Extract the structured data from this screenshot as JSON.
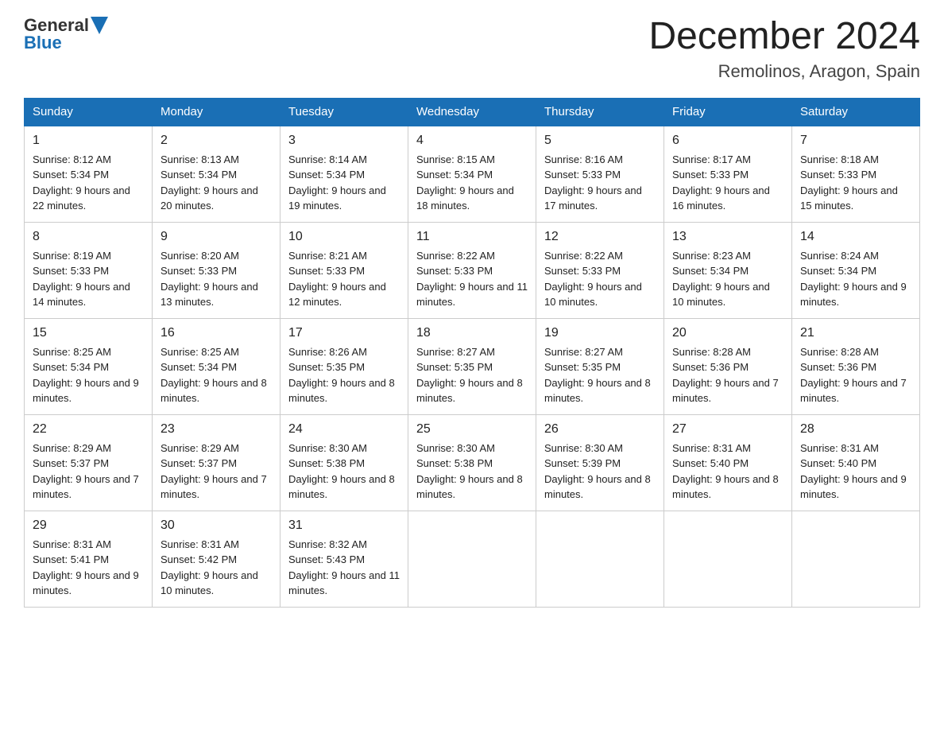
{
  "header": {
    "logo_general": "General",
    "logo_blue": "Blue",
    "month_title": "December 2024",
    "location": "Remolinos, Aragon, Spain"
  },
  "days_of_week": [
    "Sunday",
    "Monday",
    "Tuesday",
    "Wednesday",
    "Thursday",
    "Friday",
    "Saturday"
  ],
  "weeks": [
    [
      {
        "day": "1",
        "sunrise": "8:12 AM",
        "sunset": "5:34 PM",
        "daylight": "9 hours and 22 minutes."
      },
      {
        "day": "2",
        "sunrise": "8:13 AM",
        "sunset": "5:34 PM",
        "daylight": "9 hours and 20 minutes."
      },
      {
        "day": "3",
        "sunrise": "8:14 AM",
        "sunset": "5:34 PM",
        "daylight": "9 hours and 19 minutes."
      },
      {
        "day": "4",
        "sunrise": "8:15 AM",
        "sunset": "5:34 PM",
        "daylight": "9 hours and 18 minutes."
      },
      {
        "day": "5",
        "sunrise": "8:16 AM",
        "sunset": "5:33 PM",
        "daylight": "9 hours and 17 minutes."
      },
      {
        "day": "6",
        "sunrise": "8:17 AM",
        "sunset": "5:33 PM",
        "daylight": "9 hours and 16 minutes."
      },
      {
        "day": "7",
        "sunrise": "8:18 AM",
        "sunset": "5:33 PM",
        "daylight": "9 hours and 15 minutes."
      }
    ],
    [
      {
        "day": "8",
        "sunrise": "8:19 AM",
        "sunset": "5:33 PM",
        "daylight": "9 hours and 14 minutes."
      },
      {
        "day": "9",
        "sunrise": "8:20 AM",
        "sunset": "5:33 PM",
        "daylight": "9 hours and 13 minutes."
      },
      {
        "day": "10",
        "sunrise": "8:21 AM",
        "sunset": "5:33 PM",
        "daylight": "9 hours and 12 minutes."
      },
      {
        "day": "11",
        "sunrise": "8:22 AM",
        "sunset": "5:33 PM",
        "daylight": "9 hours and 11 minutes."
      },
      {
        "day": "12",
        "sunrise": "8:22 AM",
        "sunset": "5:33 PM",
        "daylight": "9 hours and 10 minutes."
      },
      {
        "day": "13",
        "sunrise": "8:23 AM",
        "sunset": "5:34 PM",
        "daylight": "9 hours and 10 minutes."
      },
      {
        "day": "14",
        "sunrise": "8:24 AM",
        "sunset": "5:34 PM",
        "daylight": "9 hours and 9 minutes."
      }
    ],
    [
      {
        "day": "15",
        "sunrise": "8:25 AM",
        "sunset": "5:34 PM",
        "daylight": "9 hours and 9 minutes."
      },
      {
        "day": "16",
        "sunrise": "8:25 AM",
        "sunset": "5:34 PM",
        "daylight": "9 hours and 8 minutes."
      },
      {
        "day": "17",
        "sunrise": "8:26 AM",
        "sunset": "5:35 PM",
        "daylight": "9 hours and 8 minutes."
      },
      {
        "day": "18",
        "sunrise": "8:27 AM",
        "sunset": "5:35 PM",
        "daylight": "9 hours and 8 minutes."
      },
      {
        "day": "19",
        "sunrise": "8:27 AM",
        "sunset": "5:35 PM",
        "daylight": "9 hours and 8 minutes."
      },
      {
        "day": "20",
        "sunrise": "8:28 AM",
        "sunset": "5:36 PM",
        "daylight": "9 hours and 7 minutes."
      },
      {
        "day": "21",
        "sunrise": "8:28 AM",
        "sunset": "5:36 PM",
        "daylight": "9 hours and 7 minutes."
      }
    ],
    [
      {
        "day": "22",
        "sunrise": "8:29 AM",
        "sunset": "5:37 PM",
        "daylight": "9 hours and 7 minutes."
      },
      {
        "day": "23",
        "sunrise": "8:29 AM",
        "sunset": "5:37 PM",
        "daylight": "9 hours and 7 minutes."
      },
      {
        "day": "24",
        "sunrise": "8:30 AM",
        "sunset": "5:38 PM",
        "daylight": "9 hours and 8 minutes."
      },
      {
        "day": "25",
        "sunrise": "8:30 AM",
        "sunset": "5:38 PM",
        "daylight": "9 hours and 8 minutes."
      },
      {
        "day": "26",
        "sunrise": "8:30 AM",
        "sunset": "5:39 PM",
        "daylight": "9 hours and 8 minutes."
      },
      {
        "day": "27",
        "sunrise": "8:31 AM",
        "sunset": "5:40 PM",
        "daylight": "9 hours and 8 minutes."
      },
      {
        "day": "28",
        "sunrise": "8:31 AM",
        "sunset": "5:40 PM",
        "daylight": "9 hours and 9 minutes."
      }
    ],
    [
      {
        "day": "29",
        "sunrise": "8:31 AM",
        "sunset": "5:41 PM",
        "daylight": "9 hours and 9 minutes."
      },
      {
        "day": "30",
        "sunrise": "8:31 AM",
        "sunset": "5:42 PM",
        "daylight": "9 hours and 10 minutes."
      },
      {
        "day": "31",
        "sunrise": "8:32 AM",
        "sunset": "5:43 PM",
        "daylight": "9 hours and 11 minutes."
      },
      null,
      null,
      null,
      null
    ]
  ]
}
